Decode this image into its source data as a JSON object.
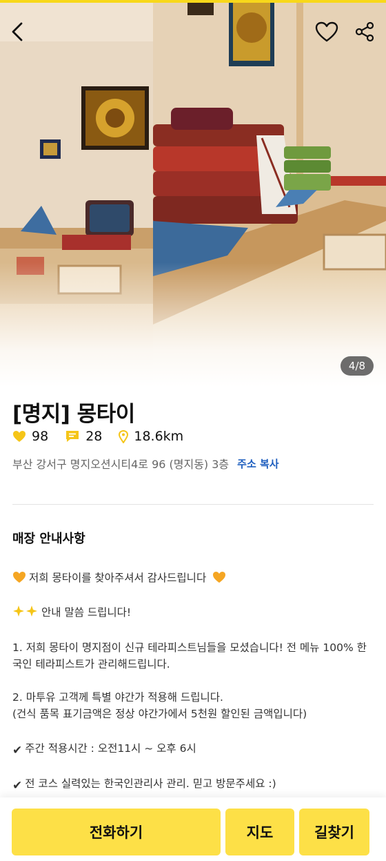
{
  "hero": {
    "page_indicator": "4/8"
  },
  "header": {
    "back_icon": "chevron-left-icon",
    "favorite_icon": "heart-outline-icon",
    "share_icon": "share-icon"
  },
  "store": {
    "title": "[명지] 몽타이",
    "likes": "98",
    "reviews": "28",
    "distance": "18.6km",
    "address": "부산 강서구 명지오션시티4로 96 (명지동) 3층",
    "copy_address_label": "주소 복사"
  },
  "colors": {
    "accent": "#fde047",
    "link": "#1f5fbf",
    "like": "#f5c518"
  },
  "notice": {
    "title": "매장 안내사항",
    "line1": "저희 몽타이를 찾아주셔서 감사드립니다",
    "line2": "안내 말씀 드립니다!",
    "line3": "1. 저희 몽타이 명지점이 신규 테라피스트님들을 모셨습니다! 전 메뉴 100% 한국인 테라피스트가 관리해드립니다.",
    "line4a": "2. 마투유 고객께 특별 야간가 적용해 드립니다.",
    "line4b": "(건식 품목 표기금액은 정상 야간가에서 5천원 할인된 금액입니다)",
    "line5": "주간 적용시간 : 오전11시 ~ 오후 6시",
    "line6": "전 코스 실력있는 한국인관리사 관리. 믿고 방문주세요 :)"
  },
  "actions": {
    "call": "전화하기",
    "map": "지도",
    "route": "길찾기"
  }
}
